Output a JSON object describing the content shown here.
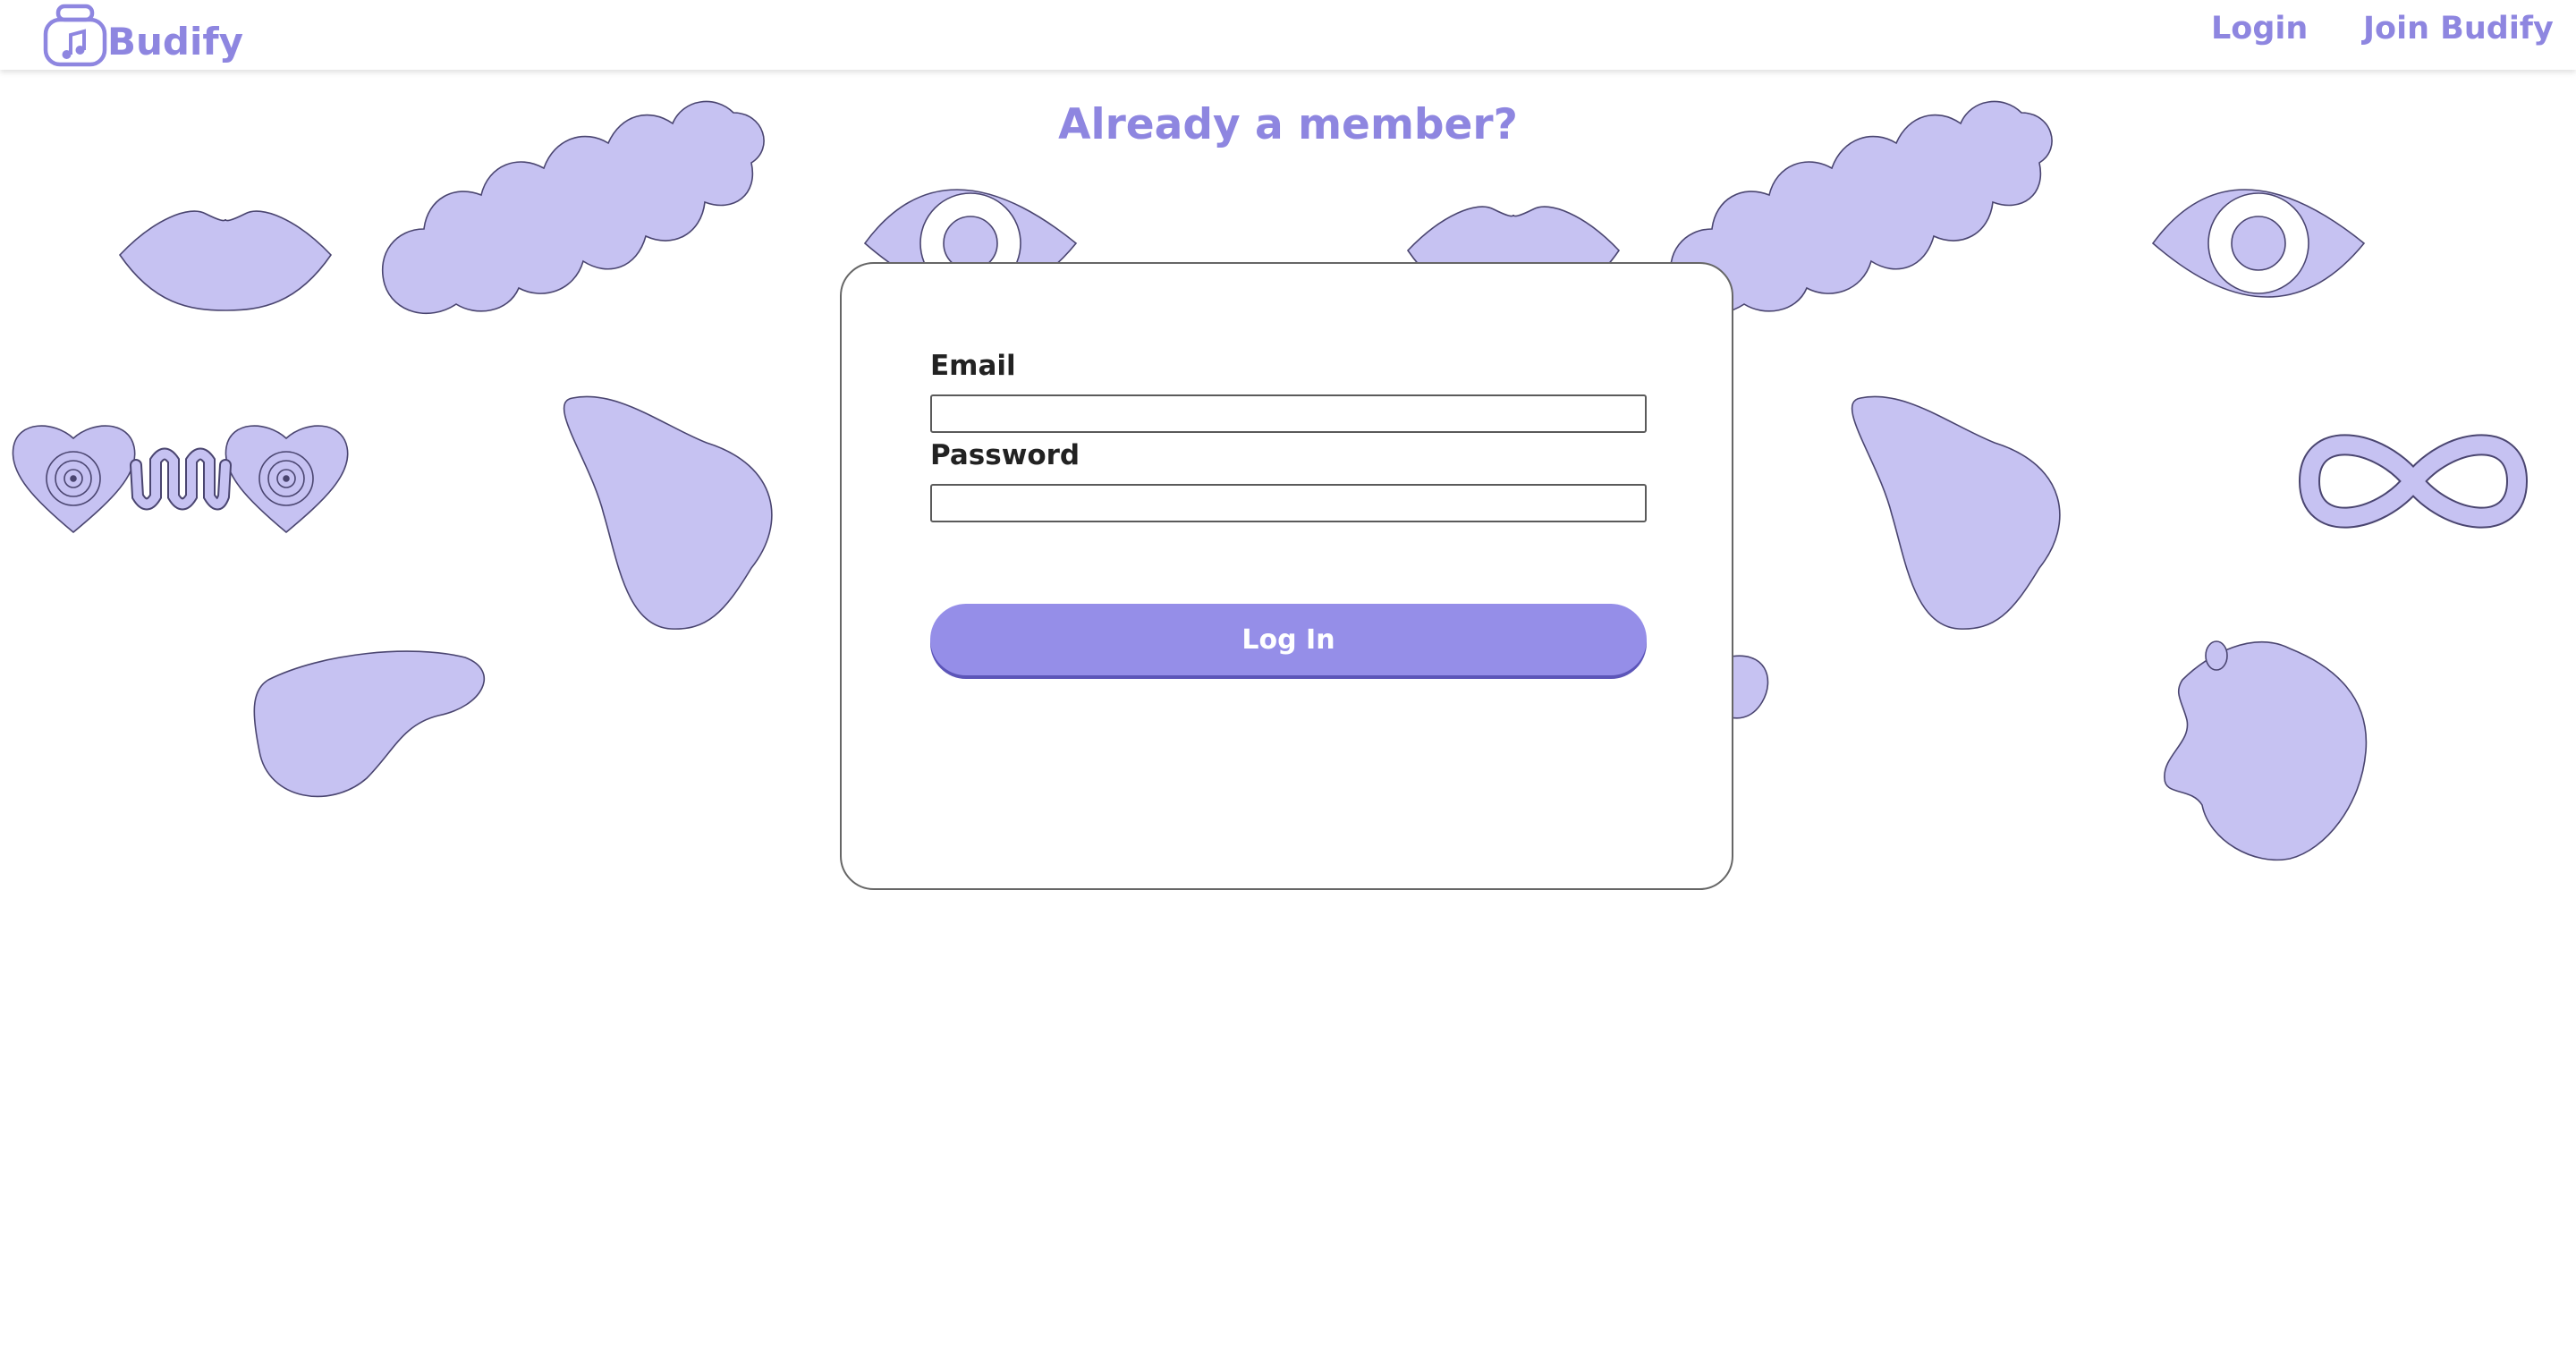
{
  "brand": {
    "name": "Budify",
    "logo_icon": "music-jar-icon",
    "color": "#8e86e0"
  },
  "nav": {
    "login_label": "Login",
    "join_label": "Join Budify"
  },
  "page": {
    "title": "Already a member?"
  },
  "form": {
    "email_label": "Email",
    "email_value": "",
    "password_label": "Password",
    "password_value": "",
    "submit_label": "Log In"
  },
  "decor": {
    "fill": "#c6c2f2",
    "stroke": "#4a4570",
    "icons": [
      "lips-icon",
      "bead-chain-icon",
      "eye-icon",
      "heart-vinyl-icon",
      "blob-icon",
      "infinity-icon",
      "splash-icon"
    ]
  },
  "colors": {
    "accent": "#8e86e0",
    "button": "#958ee8",
    "button_shadow": "#5c55b8",
    "text": "#222222"
  }
}
